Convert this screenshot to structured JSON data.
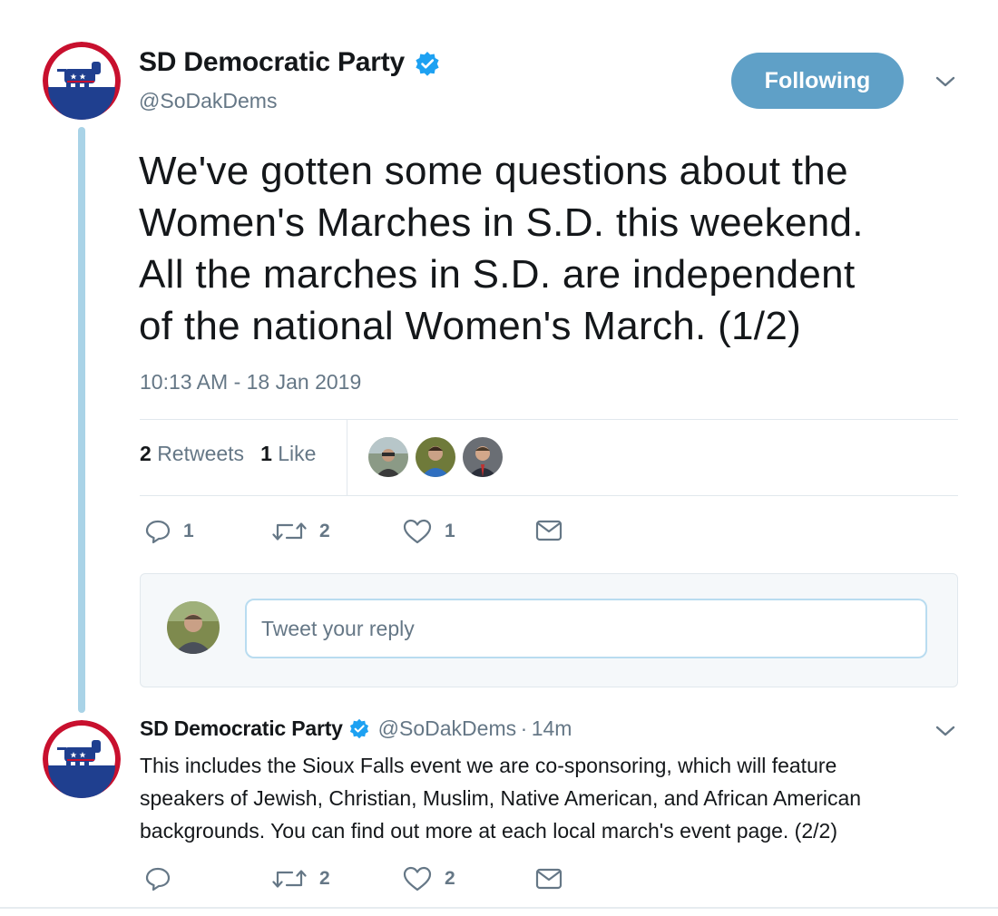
{
  "tweet": {
    "author_name": "SD Democratic Party",
    "author_handle": "@SoDakDems",
    "follow_label": "Following",
    "text": "We've gotten some questions about the\nWomen's Marches in S.D. this weekend.\nAll the marches in S.D. are independent\nof the national Women's March. (1/2)",
    "timestamp": "10:13 AM - 18 Jan 2019",
    "retweets_count": "2",
    "retweets_label": "Retweets",
    "likes_count": "1",
    "likes_label": "Like",
    "actions": {
      "reply_count": "1",
      "retweet_count": "2",
      "like_count": "1"
    }
  },
  "reply_composer": {
    "placeholder": "Tweet your reply"
  },
  "thread_reply": {
    "author_name": "SD Democratic Party",
    "author_handle": "@SoDakDems",
    "separator": "·",
    "age": "14m",
    "text": "This includes the Sioux Falls event we are co-sponsoring, which will feature\nspeakers of Jewish, Christian, Muslim, Native American, and African American\nbackgrounds. You can find out more at each local march's event page. (2/2)",
    "actions": {
      "reply_count": "",
      "retweet_count": "2",
      "like_count": "2"
    }
  },
  "colors": {
    "follow_button": "#5fa0c7",
    "verified": "#1da1f2",
    "thread_line": "#a9d3e7",
    "secondary_text": "#657786"
  },
  "icons": [
    "party-logo",
    "verified-badge-icon",
    "chevron-down-icon",
    "reply-icon",
    "retweet-icon",
    "heart-icon",
    "direct-message-icon"
  ]
}
